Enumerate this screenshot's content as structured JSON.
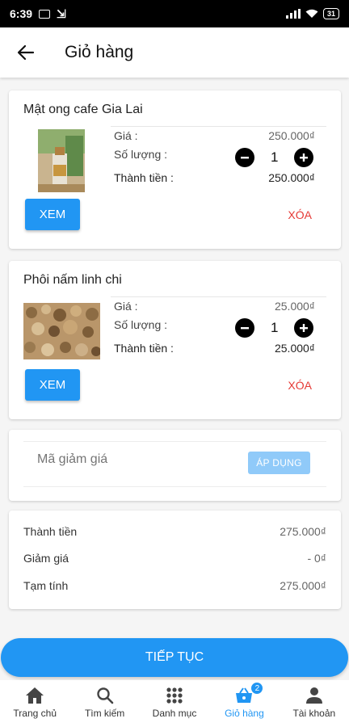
{
  "status_bar": {
    "time": "6:39",
    "battery": "31"
  },
  "header": {
    "title": "Giỏ hàng"
  },
  "products": [
    {
      "name": "Mật ong cafe Gia Lai",
      "price_label": "Giá :",
      "price": "250.000₫",
      "qty_label": "Số lượng :",
      "qty": "1",
      "total_label": "Thành tiền :",
      "total": "250.000₫",
      "view_label": "XEM",
      "delete_label": "XÓA"
    },
    {
      "name": "Phôi nấm linh chi",
      "price_label": "Giá :",
      "price": "25.000₫",
      "qty_label": "Số lượng :",
      "qty": "1",
      "total_label": "Thành tiền :",
      "total": "25.000₫",
      "view_label": "XEM",
      "delete_label": "XÓA"
    }
  ],
  "coupon": {
    "placeholder": "Mã giảm giá",
    "apply_label": "ÁP DỤNG"
  },
  "summary": {
    "subtotal_label": "Thành tiền",
    "subtotal": "275.000₫",
    "discount_label": "Giảm giá",
    "discount": "- 0₫",
    "total_label": "Tạm tính",
    "total": "275.000₫"
  },
  "checkout": {
    "label": "TIẾP TỤC"
  },
  "nav": {
    "items": [
      {
        "label": "Trang chủ",
        "icon": "home-icon"
      },
      {
        "label": "Tìm kiếm",
        "icon": "search-icon"
      },
      {
        "label": "Danh mục",
        "icon": "grid-icon"
      },
      {
        "label": "Giỏ hàng",
        "icon": "cart-icon",
        "badge": "2"
      },
      {
        "label": "Tài khoản",
        "icon": "account-icon"
      }
    ]
  },
  "colors": {
    "primary": "#2196f3",
    "danger": "#e53935",
    "apply_disabled": "#90caf9"
  }
}
